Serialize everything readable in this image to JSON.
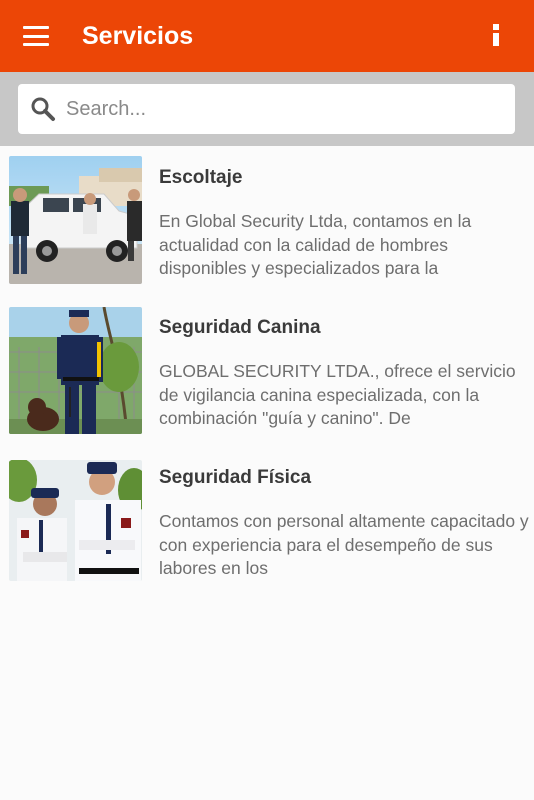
{
  "appbar": {
    "title": "Servicios",
    "color": "#ec4606",
    "menu_icon": "hamburger-menu-icon",
    "info_icon": "info-icon"
  },
  "search": {
    "placeholder": "Search...",
    "value": "",
    "icon": "search-icon"
  },
  "services": [
    {
      "title": "Escoltaje",
      "description": "En Global Security Ltda, contamos en la actualidad con la calidad de hombres disponibles y especializados para la"
    },
    {
      "title": "Seguridad Canina",
      "description": "GLOBAL SECURITY LTDA., ofrece el servicio de vigilancia canina especializada, con la combinación \"guía y canino\". De"
    },
    {
      "title": "Seguridad Física",
      "description": "Contamos con personal altamente capacitado y con experiencia para el desempeño de sus labores en los"
    }
  ]
}
